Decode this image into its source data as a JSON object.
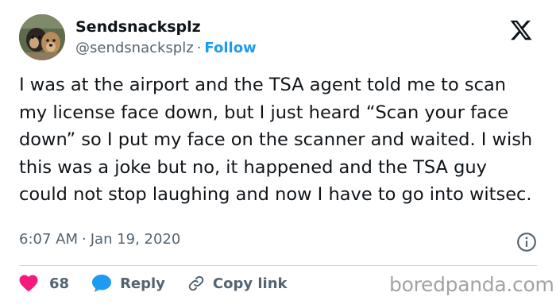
{
  "author": {
    "display_name": "Sendsnacksplz",
    "handle": "@sendsnacksplz",
    "separator": "·",
    "follow_label": "Follow"
  },
  "tweet": {
    "text": "I was at the airport and the TSA agent told me to scan my license face down, but I just heard “Scan your face down” so I put my face on the scanner and waited. I wish this was a joke but no, it happened and the TSA guy could not stop laughing and now I have to go into witsec.",
    "time": "6:07 AM",
    "date_separator": "·",
    "date": "Jan 19, 2020"
  },
  "actions": {
    "likes_count": "68",
    "reply_label": "Reply",
    "copy_link_label": "Copy link"
  },
  "watermark": "boredpanda.com",
  "icons": {
    "avatar": "avatar-photo",
    "platform_logo": "x-logo-icon",
    "info": "info-icon",
    "like": "heart-icon",
    "reply": "speech-bubble-icon",
    "copy_link": "link-icon"
  },
  "colors": {
    "accent": "#1d9bf0",
    "like": "#f91880",
    "text_primary": "#0f1419",
    "text_secondary": "#536471",
    "watermark": "#a3a3a3"
  }
}
